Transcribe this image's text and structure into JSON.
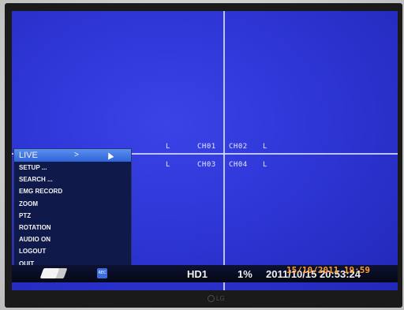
{
  "channels": {
    "top": {
      "left_flag": "L",
      "ch1": "CH01",
      "ch2": "CH02",
      "right_flag": "L"
    },
    "bottom": {
      "left_flag": "L",
      "ch1": "CH03",
      "ch2": "CH04",
      "right_flag": "L"
    }
  },
  "menu": {
    "items": [
      {
        "label": "LIVE",
        "selected": true,
        "submenu_indicator": ">"
      },
      {
        "label": "SETUP ..."
      },
      {
        "label": "SEARCH ..."
      },
      {
        "label": "EMG RECORD"
      },
      {
        "label": "ZOOM"
      },
      {
        "label": "PTZ"
      },
      {
        "label": "ROTATION"
      },
      {
        "label": "AUDIO ON"
      },
      {
        "label": "LOGOUT"
      },
      {
        "label": "QUIT"
      }
    ]
  },
  "statusbar": {
    "icons": [
      "book-icon",
      "rec-icon"
    ],
    "rec_label": "REC",
    "quality": "HD1",
    "disk_usage": "1%",
    "datetime": "2011/10/15 20:53:24"
  },
  "photo_timestamp": "15/10/2011 19:59",
  "brand": "LG",
  "colors": {
    "screen": "#2e36d6",
    "menu_bg": "#101a4a",
    "selected": "#3f78e4",
    "stamp": "#ff9d2e"
  }
}
